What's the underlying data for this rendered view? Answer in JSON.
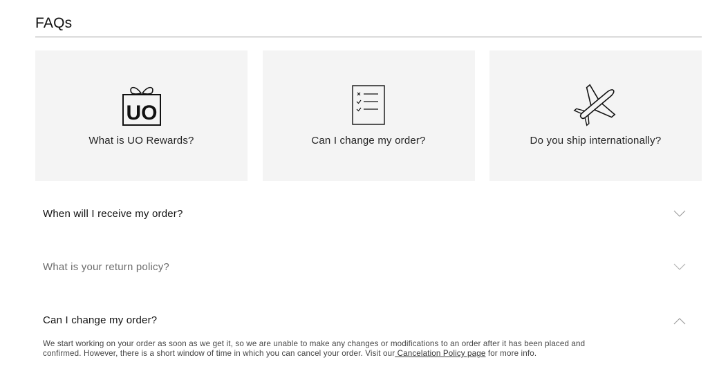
{
  "faqs": {
    "title": "FAQs"
  },
  "cards": [
    {
      "icon": "gift-box-uo-icon",
      "icon_text": "UO",
      "label": "What is UO Rewards?"
    },
    {
      "icon": "checklist-icon",
      "label": "Can I change my order?"
    },
    {
      "icon": "airplane-icon",
      "label": "Do you ship internationally?"
    }
  ],
  "accordion": [
    {
      "question": "When will I receive my order?",
      "expanded": false,
      "icon": "chevron-down-icon"
    },
    {
      "question": "What is your return policy?",
      "expanded": false,
      "icon": "chevron-down-icon"
    },
    {
      "question": "Can I change my order?",
      "expanded": true,
      "icon": "chevron-up-icon",
      "answer_text": "We start working on your order as soon as we get it, so we are unable to make any changes or modifications to an order after it has been placed and confirmed. However, there is a short window of time in which you can cancel your order. Visit our",
      "answer_link": " Cancelation Policy page",
      "answer_suffix": " for more info."
    }
  ]
}
